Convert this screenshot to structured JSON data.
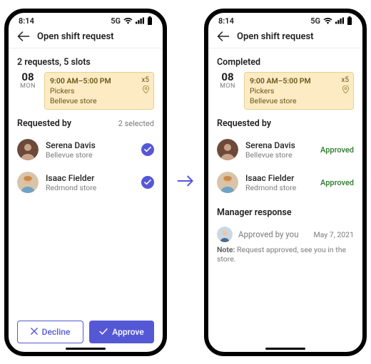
{
  "status_bar": {
    "time": "8:14",
    "network": "5G"
  },
  "header": {
    "title": "Open shift request"
  },
  "shift": {
    "day": "08",
    "weekday": "MON",
    "time": "9:00 AM–5:00 PM",
    "role": "Pickers",
    "location": "Bellevue store",
    "slots": "x5"
  },
  "left": {
    "summary": "2 requests, 5 slots",
    "section": "Requested by",
    "selected": "2 selected",
    "people": [
      {
        "name": "Serena Davis",
        "store": "Bellevue store"
      },
      {
        "name": "Isaac Fielder",
        "store": "Redmond store"
      }
    ],
    "decline": "Decline",
    "approve": "Approve"
  },
  "right": {
    "summary": "Completed",
    "section": "Requested by",
    "people": [
      {
        "name": "Serena Davis",
        "store": "Bellevue store",
        "status": "Approved"
      },
      {
        "name": "Isaac Fielder",
        "store": "Redmond store",
        "status": "Approved"
      }
    ],
    "mr_title": "Manager response",
    "mr_text": "Approved by you",
    "mr_date": "May 7, 2021",
    "note_label": "Note:",
    "note": "Request approved, see you in the store."
  }
}
